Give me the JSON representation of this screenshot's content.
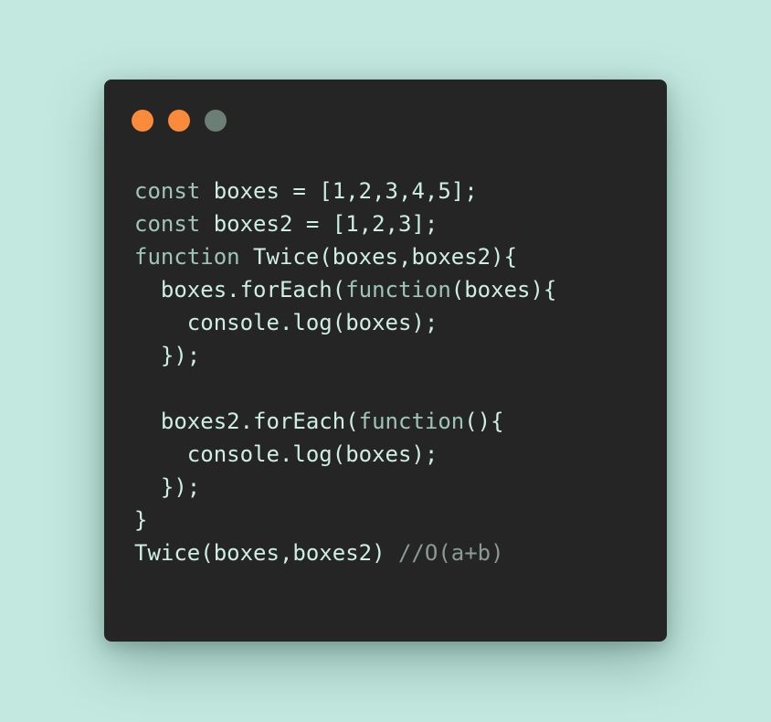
{
  "window": {
    "dots": [
      {
        "name": "close-dot",
        "color": "#f98b3b"
      },
      {
        "name": "minimize-dot",
        "color": "#f98b3b"
      },
      {
        "name": "maximize-dot",
        "color": "#6b7f76"
      }
    ]
  },
  "colors": {
    "background": "#c3e8df",
    "window_bg": "#252525",
    "keyword": "#9fc4b8",
    "plain": "#cdeee4",
    "comment": "#8a9a94"
  },
  "code": {
    "lines": [
      [
        {
          "t": "const ",
          "c": "keyword"
        },
        {
          "t": "boxes = [1,2,3,4,5];",
          "c": "plain"
        }
      ],
      [
        {
          "t": "const ",
          "c": "keyword"
        },
        {
          "t": "boxes2 = [1,2,3];",
          "c": "plain"
        }
      ],
      [
        {
          "t": "function ",
          "c": "keyword"
        },
        {
          "t": "Twice(boxes,boxes2){",
          "c": "plain"
        }
      ],
      [
        {
          "t": "  boxes.forEach(",
          "c": "plain"
        },
        {
          "t": "function",
          "c": "keyword"
        },
        {
          "t": "(boxes){",
          "c": "plain"
        }
      ],
      [
        {
          "t": "    console.log(boxes);",
          "c": "plain"
        }
      ],
      [
        {
          "t": "  });",
          "c": "plain"
        }
      ],
      [
        {
          "t": "",
          "c": "plain"
        }
      ],
      [
        {
          "t": "  boxes2.forEach(",
          "c": "plain"
        },
        {
          "t": "function",
          "c": "keyword"
        },
        {
          "t": "(){",
          "c": "plain"
        }
      ],
      [
        {
          "t": "    console.log(boxes);",
          "c": "plain"
        }
      ],
      [
        {
          "t": "  });",
          "c": "plain"
        }
      ],
      [
        {
          "t": "}",
          "c": "plain"
        }
      ],
      [
        {
          "t": "Twice(boxes,boxes2) ",
          "c": "plain"
        },
        {
          "t": "//O(a+b)",
          "c": "comment"
        }
      ]
    ]
  }
}
